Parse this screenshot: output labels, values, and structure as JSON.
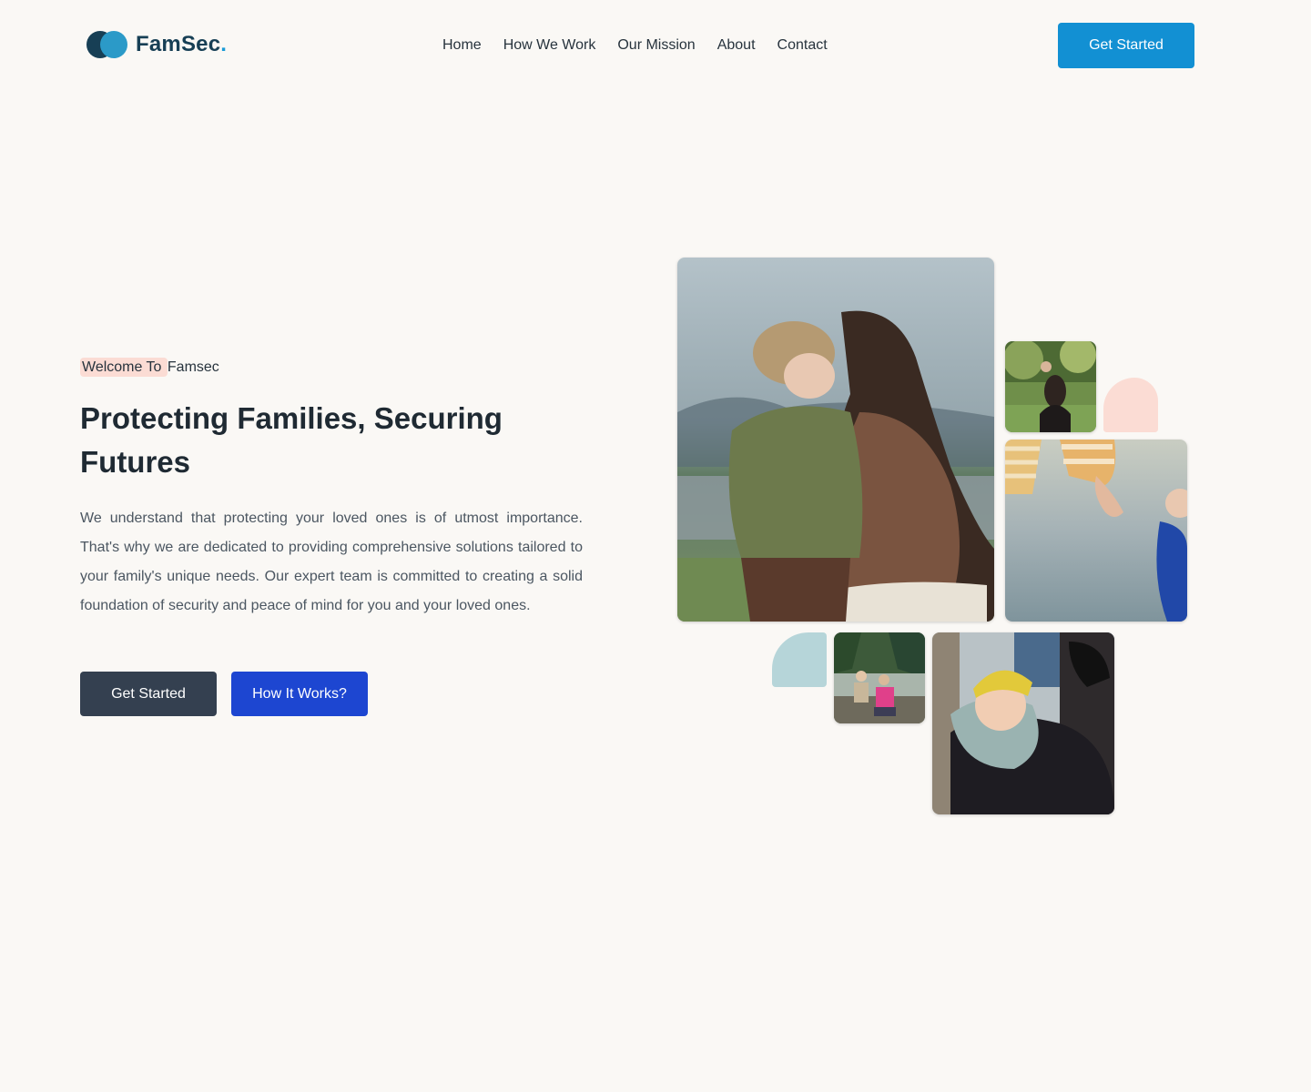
{
  "brand": {
    "name": "FamSec",
    "dot": ".",
    "logo_icon": "overlapping-circles-logo"
  },
  "nav": {
    "items": [
      {
        "label": "Home"
      },
      {
        "label": "How We Work"
      },
      {
        "label": "Our Mission"
      },
      {
        "label": "About"
      },
      {
        "label": "Contact"
      }
    ]
  },
  "header": {
    "cta_label": "Get Started"
  },
  "hero": {
    "welcome_highlight": "Welcome To ",
    "welcome_rest": "Famsec",
    "title": "Protecting Families, Securing Futures",
    "description": "We understand that protecting your loved ones is of utmost importance. That's why we are dedicated to providing comprehensive solutions tailored to your family's unique needs. Our expert team is committed to creating a solid foundation of security and peace of mind for you and your loved ones.",
    "primary_label": "Get Started",
    "secondary_label": "How It Works?"
  },
  "colors": {
    "background": "#faf8f5",
    "brand_dark": "#173f55",
    "brand_accent": "#1a9bd7",
    "header_button": "#1290d3",
    "dark_button": "#344050",
    "blue_button": "#1d46d1",
    "highlight_pink": "#fbdcd4",
    "deco_teal": "#b6d5d9"
  }
}
